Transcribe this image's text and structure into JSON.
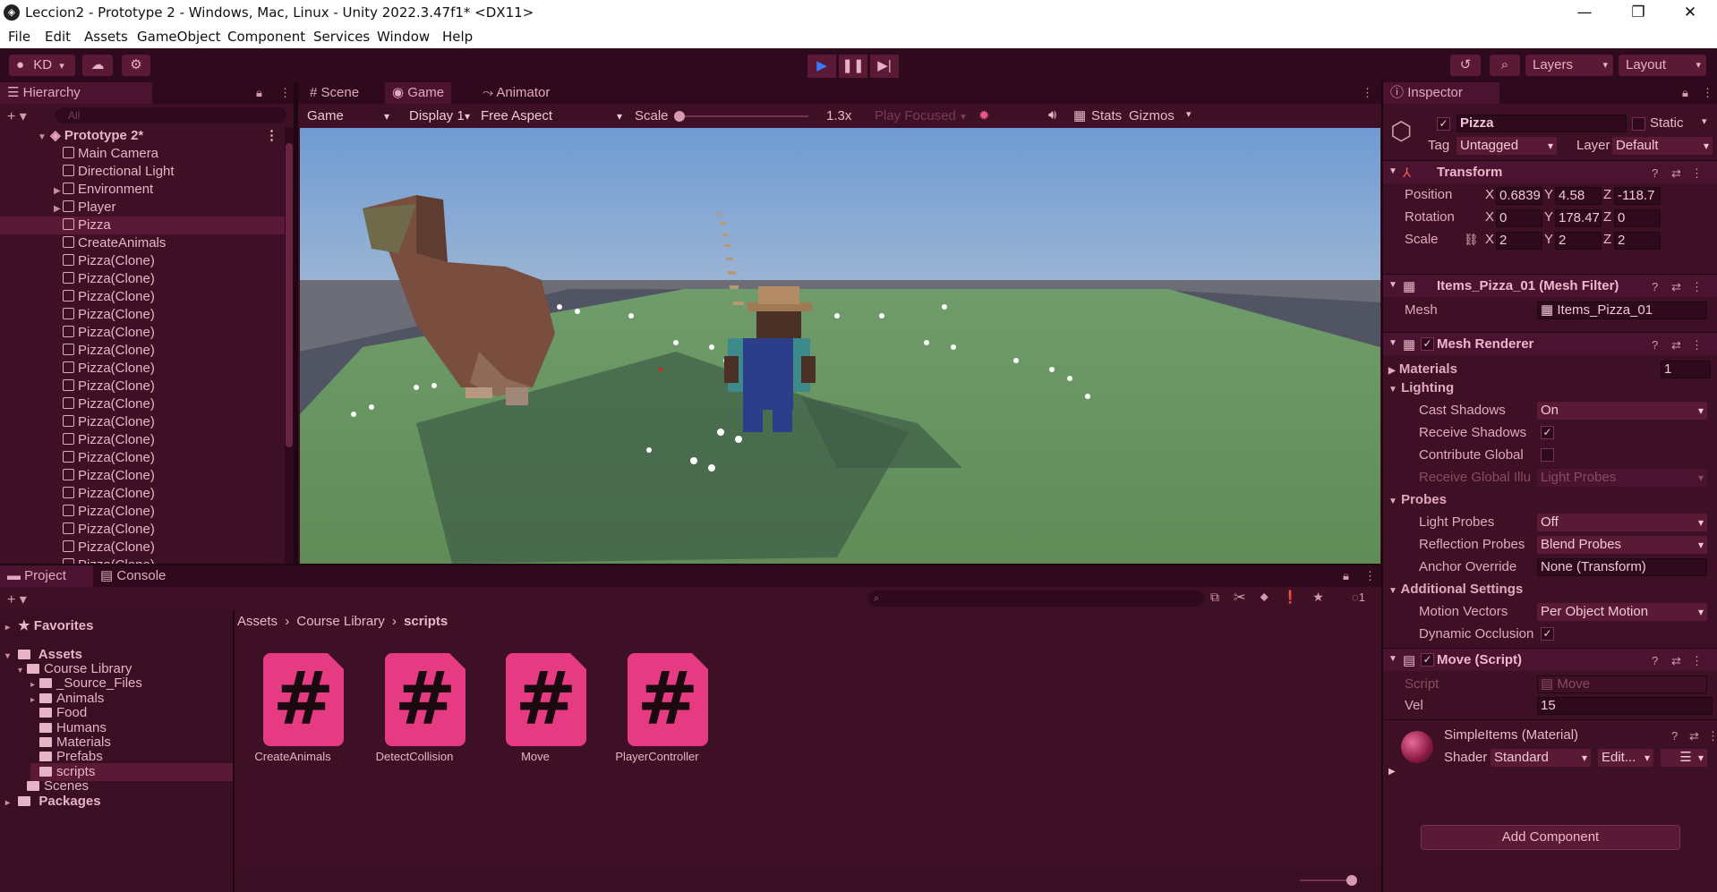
{
  "window": {
    "title": "Leccion2 - Prototype 2 - Windows, Mac, Linux - Unity 2022.3.47f1* <DX11>",
    "controls": [
      "—",
      "❐",
      "✕"
    ]
  },
  "menu": [
    "File",
    "Edit",
    "Assets",
    "GameObject",
    "Component",
    "Services",
    "Window",
    "Help"
  ],
  "toolbar": {
    "account": "KD",
    "layers": "Layers",
    "layout": "Layout"
  },
  "hierarchy": {
    "tab": "Hierarchy",
    "search_placeholder": "All",
    "scene": "Prototype 2*",
    "items": [
      "Main Camera",
      "Directional Light",
      "Environment",
      "Player",
      "Pizza",
      "CreateAnimals",
      "Pizza(Clone)",
      "Pizza(Clone)",
      "Pizza(Clone)",
      "Pizza(Clone)",
      "Pizza(Clone)",
      "Pizza(Clone)",
      "Pizza(Clone)",
      "Pizza(Clone)",
      "Pizza(Clone)",
      "Pizza(Clone)",
      "Pizza(Clone)",
      "Pizza(Clone)",
      "Pizza(Clone)",
      "Pizza(Clone)",
      "Pizza(Clone)",
      "Pizza(Clone)",
      "Pizza(Clone)",
      "Pizza(Clone)"
    ],
    "selected": "Pizza"
  },
  "gameview": {
    "tabs": [
      "Scene",
      "Game",
      "Animator"
    ],
    "active_tab": "Game",
    "mode": "Game",
    "display": "Display 1",
    "aspect": "Free Aspect",
    "scale_label": "Scale",
    "scale_value": "1.3x",
    "play_focused": "Play Focused",
    "stats": "Stats",
    "gizmos": "Gizmos"
  },
  "project": {
    "tabs": [
      "Project",
      "Console"
    ],
    "badge": "1",
    "favorites": "Favorites",
    "assets": "Assets",
    "tree": [
      "Course Library",
      "_Source_Files",
      "Animals",
      "Food",
      "Humans",
      "Materials",
      "Prefabs",
      "scripts",
      "Scenes"
    ],
    "packages": "Packages",
    "breadcrumb": [
      "Assets",
      "Course Library",
      "scripts"
    ],
    "files": [
      "CreateAnimals",
      "DetectCollision",
      "Move",
      "PlayerController"
    ]
  },
  "inspector": {
    "tab": "Inspector",
    "object_name": "Pizza",
    "static_label": "Static",
    "tag_label": "Tag",
    "tag_value": "Untagged",
    "layer_label": "Layer",
    "layer_value": "Default",
    "transform": {
      "title": "Transform",
      "position_label": "Position",
      "rotation_label": "Rotation",
      "scale_label": "Scale",
      "position": [
        "0.6839",
        "4.58",
        "-118.7"
      ],
      "rotation": [
        "0",
        "178.47",
        "0"
      ],
      "scale": [
        "2",
        "2",
        "2"
      ]
    },
    "mesh_filter": {
      "title": "Items_Pizza_01 (Mesh Filter)",
      "mesh_label": "Mesh",
      "mesh_value": "Items_Pizza_01"
    },
    "mesh_renderer": {
      "title": "Mesh Renderer",
      "materials": "Materials",
      "materials_count": "1",
      "lighting": "Lighting",
      "cast_shadows": "Cast Shadows",
      "cast_shadows_value": "On",
      "receive_shadows": "Receive Shadows",
      "contribute_global": "Contribute Global",
      "receive_global": "Receive Global Illu",
      "receive_global_value": "Light Probes",
      "probes": "Probes",
      "light_probes": "Light Probes",
      "light_probes_value": "Off",
      "reflection_probes": "Reflection Probes",
      "reflection_probes_value": "Blend Probes",
      "anchor_override": "Anchor Override",
      "anchor_override_value": "None (Transform)",
      "additional": "Additional Settings",
      "motion_vectors": "Motion Vectors",
      "motion_vectors_value": "Per Object Motion",
      "dynamic_occlusion": "Dynamic Occlusion"
    },
    "move_script": {
      "title": "Move (Script)",
      "script_label": "Script",
      "script_value": "Move",
      "vel_label": "Vel",
      "vel_value": "15"
    },
    "material": {
      "title": "SimpleItems (Material)",
      "shader_label": "Shader",
      "shader_value": "Standard",
      "edit": "Edit..."
    },
    "add_component": "Add Component"
  },
  "colors": {
    "background": "#3d1026",
    "panel_dark": "#2e0a1c",
    "accent": "#e63a82",
    "play_icon": "#3a7bff"
  }
}
